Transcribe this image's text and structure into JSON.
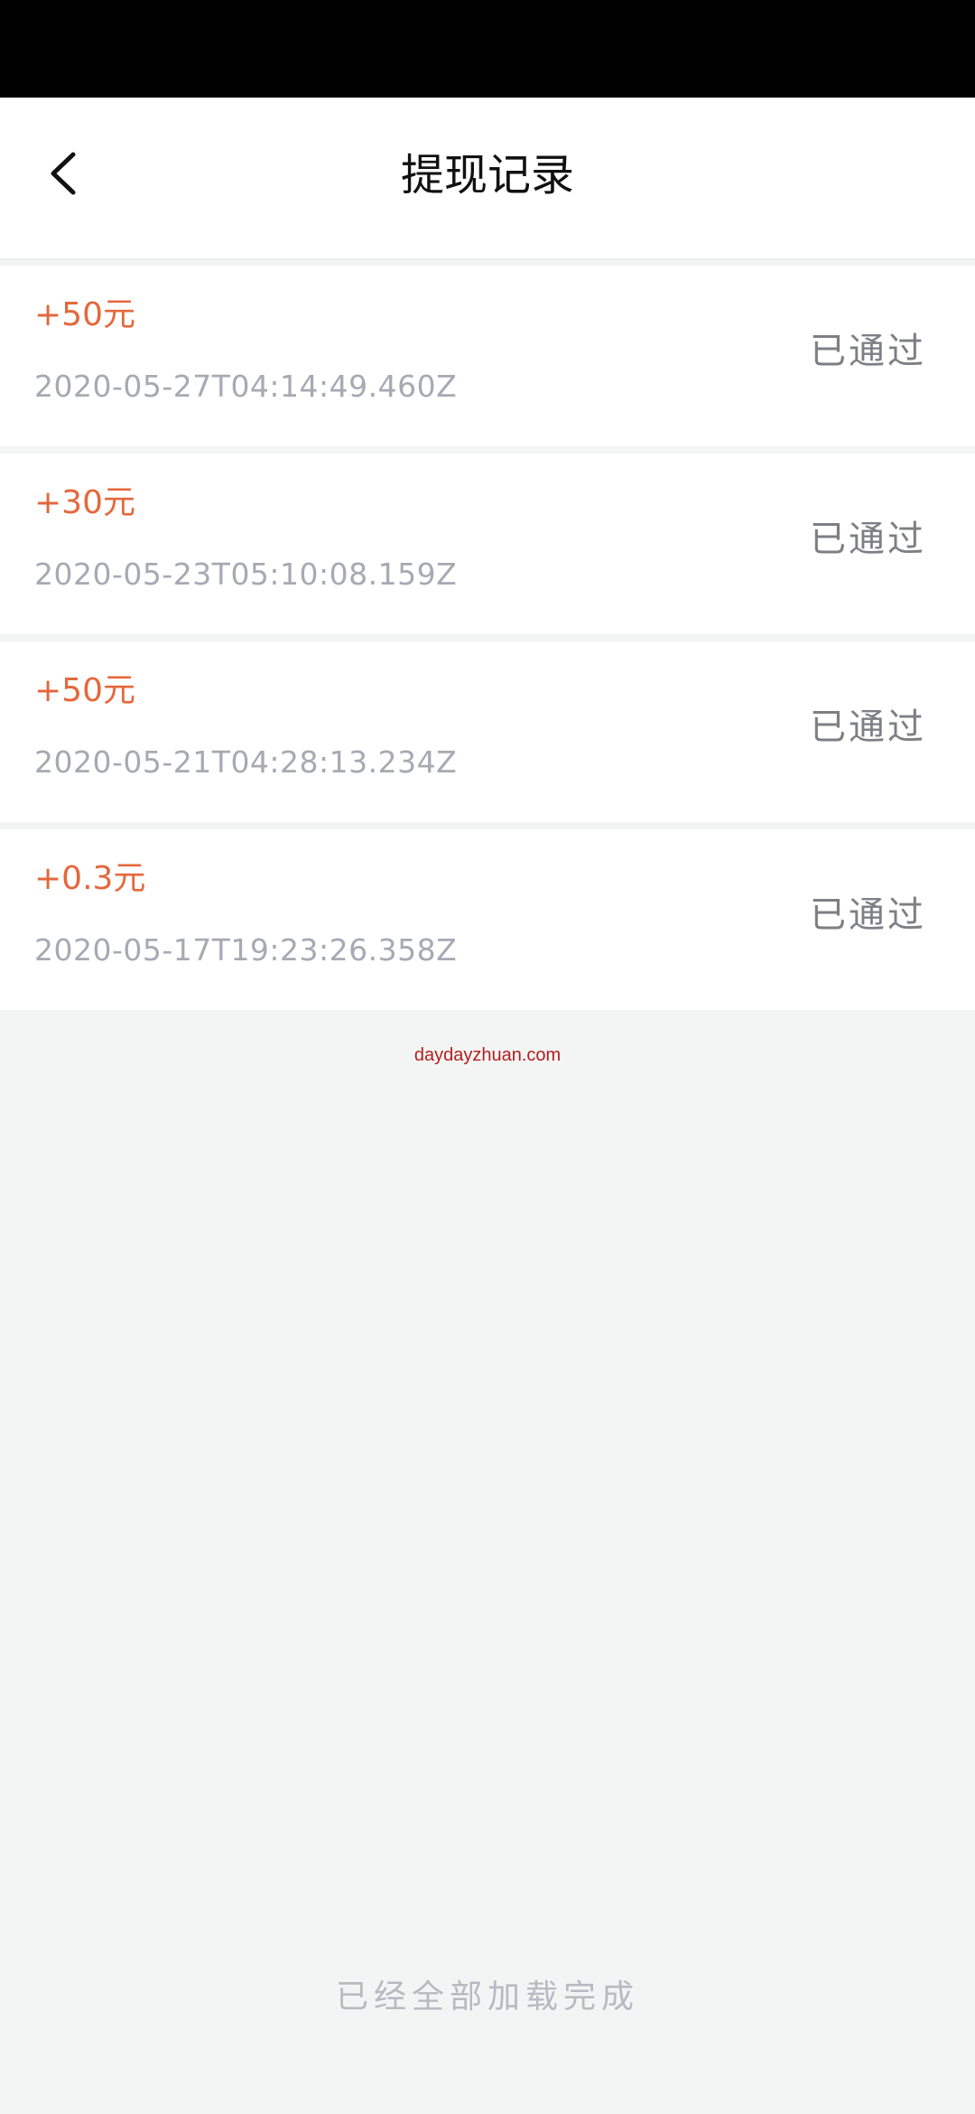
{
  "header": {
    "title": "提现记录",
    "back_icon": "chevron-left-icon"
  },
  "records": [
    {
      "amount": "+50元",
      "time": "2020-05-27T04:14:49.460Z",
      "status": "已通过"
    },
    {
      "amount": "+30元",
      "time": "2020-05-23T05:10:08.159Z",
      "status": "已通过"
    },
    {
      "amount": "+50元",
      "time": "2020-05-21T04:28:13.234Z",
      "status": "已通过"
    },
    {
      "amount": "+0.3元",
      "time": "2020-05-17T19:23:26.358Z",
      "status": "已通过"
    }
  ],
  "watermark": "daydayzhuan.com",
  "footer": {
    "load_complete": "已经全部加载完成"
  },
  "colors": {
    "amount": "#e4683c",
    "time": "#a7a9b3",
    "status": "#7e7f85",
    "background": "#f3f4f4"
  }
}
